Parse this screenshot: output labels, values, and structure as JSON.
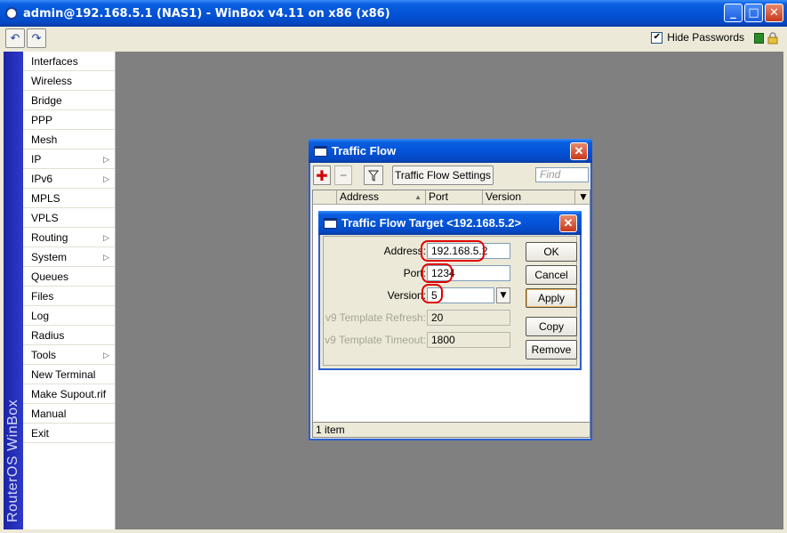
{
  "window": {
    "title": "admin@192.168.5.1 (NAS1) - WinBox v4.11 on x86 (x86)",
    "minimize": "_",
    "maximize": "□",
    "close": "✕"
  },
  "toolbar": {
    "undo_icon": "↶",
    "redo_icon": "↷",
    "hide_passwords_label": "Hide Passwords",
    "hide_passwords_checked": "✔",
    "status_color": "#2a8a2a"
  },
  "sidebar": {
    "brand": "RouterOS WinBox",
    "items": [
      {
        "label": "Interfaces",
        "arrow": ""
      },
      {
        "label": "Wireless",
        "arrow": ""
      },
      {
        "label": "Bridge",
        "arrow": ""
      },
      {
        "label": "PPP",
        "arrow": ""
      },
      {
        "label": "Mesh",
        "arrow": ""
      },
      {
        "label": "IP",
        "arrow": "▷"
      },
      {
        "label": "IPv6",
        "arrow": "▷"
      },
      {
        "label": "MPLS",
        "arrow": ""
      },
      {
        "label": "VPLS",
        "arrow": ""
      },
      {
        "label": "Routing",
        "arrow": "▷"
      },
      {
        "label": "System",
        "arrow": "▷"
      },
      {
        "label": "Queues",
        "arrow": ""
      },
      {
        "label": "Files",
        "arrow": ""
      },
      {
        "label": "Log",
        "arrow": ""
      },
      {
        "label": "Radius",
        "arrow": ""
      },
      {
        "label": "Tools",
        "arrow": "▷"
      },
      {
        "label": "New Terminal",
        "arrow": ""
      },
      {
        "label": "Make Supout.rif",
        "arrow": ""
      },
      {
        "label": "Manual",
        "arrow": ""
      },
      {
        "label": "Exit",
        "arrow": ""
      }
    ]
  },
  "traffic_flow": {
    "title": "Traffic Flow",
    "close": "✕",
    "add_icon": "✚",
    "remove_icon": "━",
    "settings_label": "Traffic Flow Settings",
    "find_placeholder": "Find",
    "columns": [
      "Address",
      "Port",
      "Version"
    ],
    "sort_mark": "▲",
    "status": "1 item"
  },
  "target": {
    "title": "Traffic Flow Target <192.168.5.2>",
    "close": "✕",
    "address_label": "Address:",
    "address": "192.168.5.2",
    "port_label": "Port:",
    "port": "1234",
    "version_label": "Version:",
    "version": "5",
    "refresh_label": "v9 Template Refresh:",
    "refresh": "20",
    "timeout_label": "v9 Template Timeout:",
    "timeout": "1800",
    "ok": "OK",
    "cancel": "Cancel",
    "apply": "Apply",
    "copy": "Copy",
    "remove": "Remove"
  },
  "highlight_color": "#e00000"
}
